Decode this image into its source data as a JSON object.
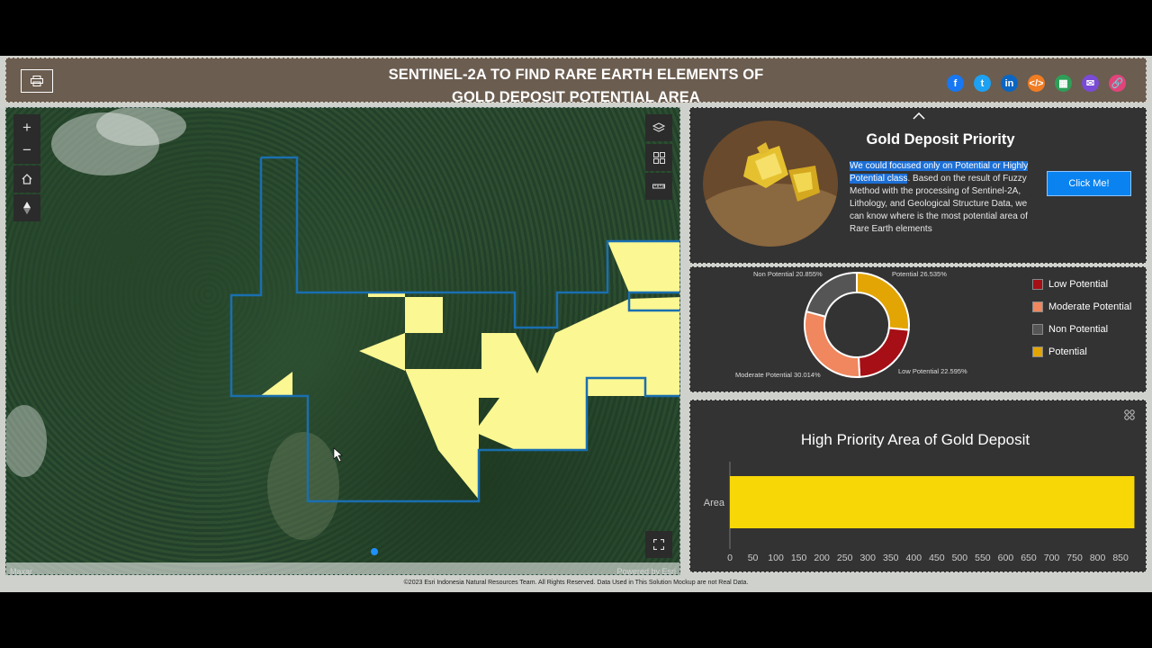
{
  "header": {
    "title_line1": "SENTINEL-2A TO FIND RARE EARTH ELEMENTS OF",
    "title_line2": "GOLD DEPOSIT POTENTIAL AREA",
    "social": [
      {
        "icon": "facebook-icon",
        "glyph": "f",
        "color": "#1877f2"
      },
      {
        "icon": "twitter-icon",
        "glyph": "t",
        "color": "#1da1f2"
      },
      {
        "icon": "linkedin-icon",
        "glyph": "in",
        "color": "#0a66c2"
      },
      {
        "icon": "embed-icon",
        "glyph": "</>",
        "color": "#f07c23"
      },
      {
        "icon": "qr-code-icon",
        "glyph": "▦",
        "color": "#2f9e58"
      },
      {
        "icon": "email-icon",
        "glyph": "✉",
        "color": "#7a4bd6"
      },
      {
        "icon": "link-icon",
        "glyph": "🔗",
        "color": "#e2447a"
      }
    ]
  },
  "map": {
    "attribution_left": "Maxar",
    "attribution_right": "Powered by Esri"
  },
  "priority": {
    "title": "Gold Deposit Priority",
    "highlight": "We could focused only on Potential or Highly Potential class",
    "text": ". Based on the result of Fuzzy Method with the processing of Sentinel-2A, Lithology, and Geological Structure Data, we can know where is the most potential area of Rare Earth elements",
    "button": "Click Me!"
  },
  "donut": {
    "legend": [
      {
        "label": "Low Potential",
        "color": "#a50f15"
      },
      {
        "label": "Moderate Potential",
        "color": "#f0875e"
      },
      {
        "label": "Non Potential",
        "color": "#555555"
      },
      {
        "label": "Potential",
        "color": "#e3a503"
      }
    ],
    "labels": {
      "potential": "Potential 26.535%",
      "non": "Non Potential 20.855%",
      "moderate": "Moderate Potential 30.014%",
      "low": "Low Potential 22.595%"
    }
  },
  "chart_data": {
    "type": "bar",
    "title": "High Priority Area of Gold Deposit",
    "categories": [
      "Area"
    ],
    "values": [
      880
    ],
    "xticks": [
      0,
      50,
      100,
      150,
      200,
      250,
      300,
      350,
      400,
      450,
      500,
      550,
      600,
      650,
      700,
      750,
      800,
      850
    ],
    "xlim": [
      0,
      885
    ],
    "bar_color": "#f8d707"
  },
  "footer": "©2023 Esri Indonesia Natural Resources Team. All Rights Reserved. Data Used in This Solution Mockup are not Real Data."
}
